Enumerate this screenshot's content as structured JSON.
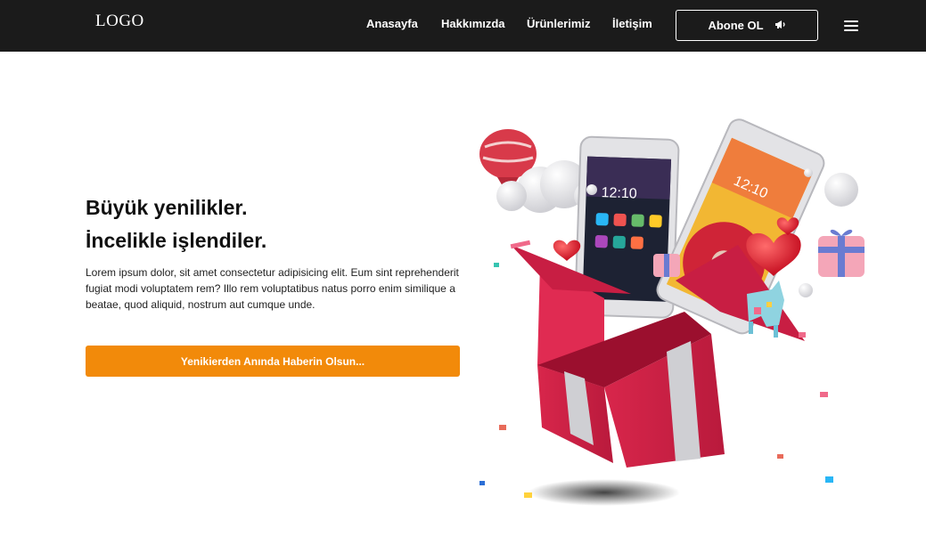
{
  "nav": {
    "logo": "LOGO",
    "links": [
      "Anasayfa",
      "Hakkımızda",
      "Ürünlerimiz",
      "İletişim"
    ],
    "subscribe_label": "Abone OL",
    "subscribe_icon": "megaphone-icon",
    "menu_icon": "hamburger-menu-icon"
  },
  "hero": {
    "title_line1": "Büyük yenilikler.",
    "title_line2": "İncelikle işlendiler.",
    "description": "Lorem ipsum dolor, sit amet consectetur adipisicing elit. Eum sint reprehenderit fugiat modi voluptatem rem? Illo rem voluptatibus natus porro enim similique a beatae, quod aliquid, nostrum aut cumque unde.",
    "cta_label": "Yenikierden Anında Haberin Olsun...",
    "accent_color": "#f28a0a",
    "navbar_color": "#1b1b1b"
  }
}
